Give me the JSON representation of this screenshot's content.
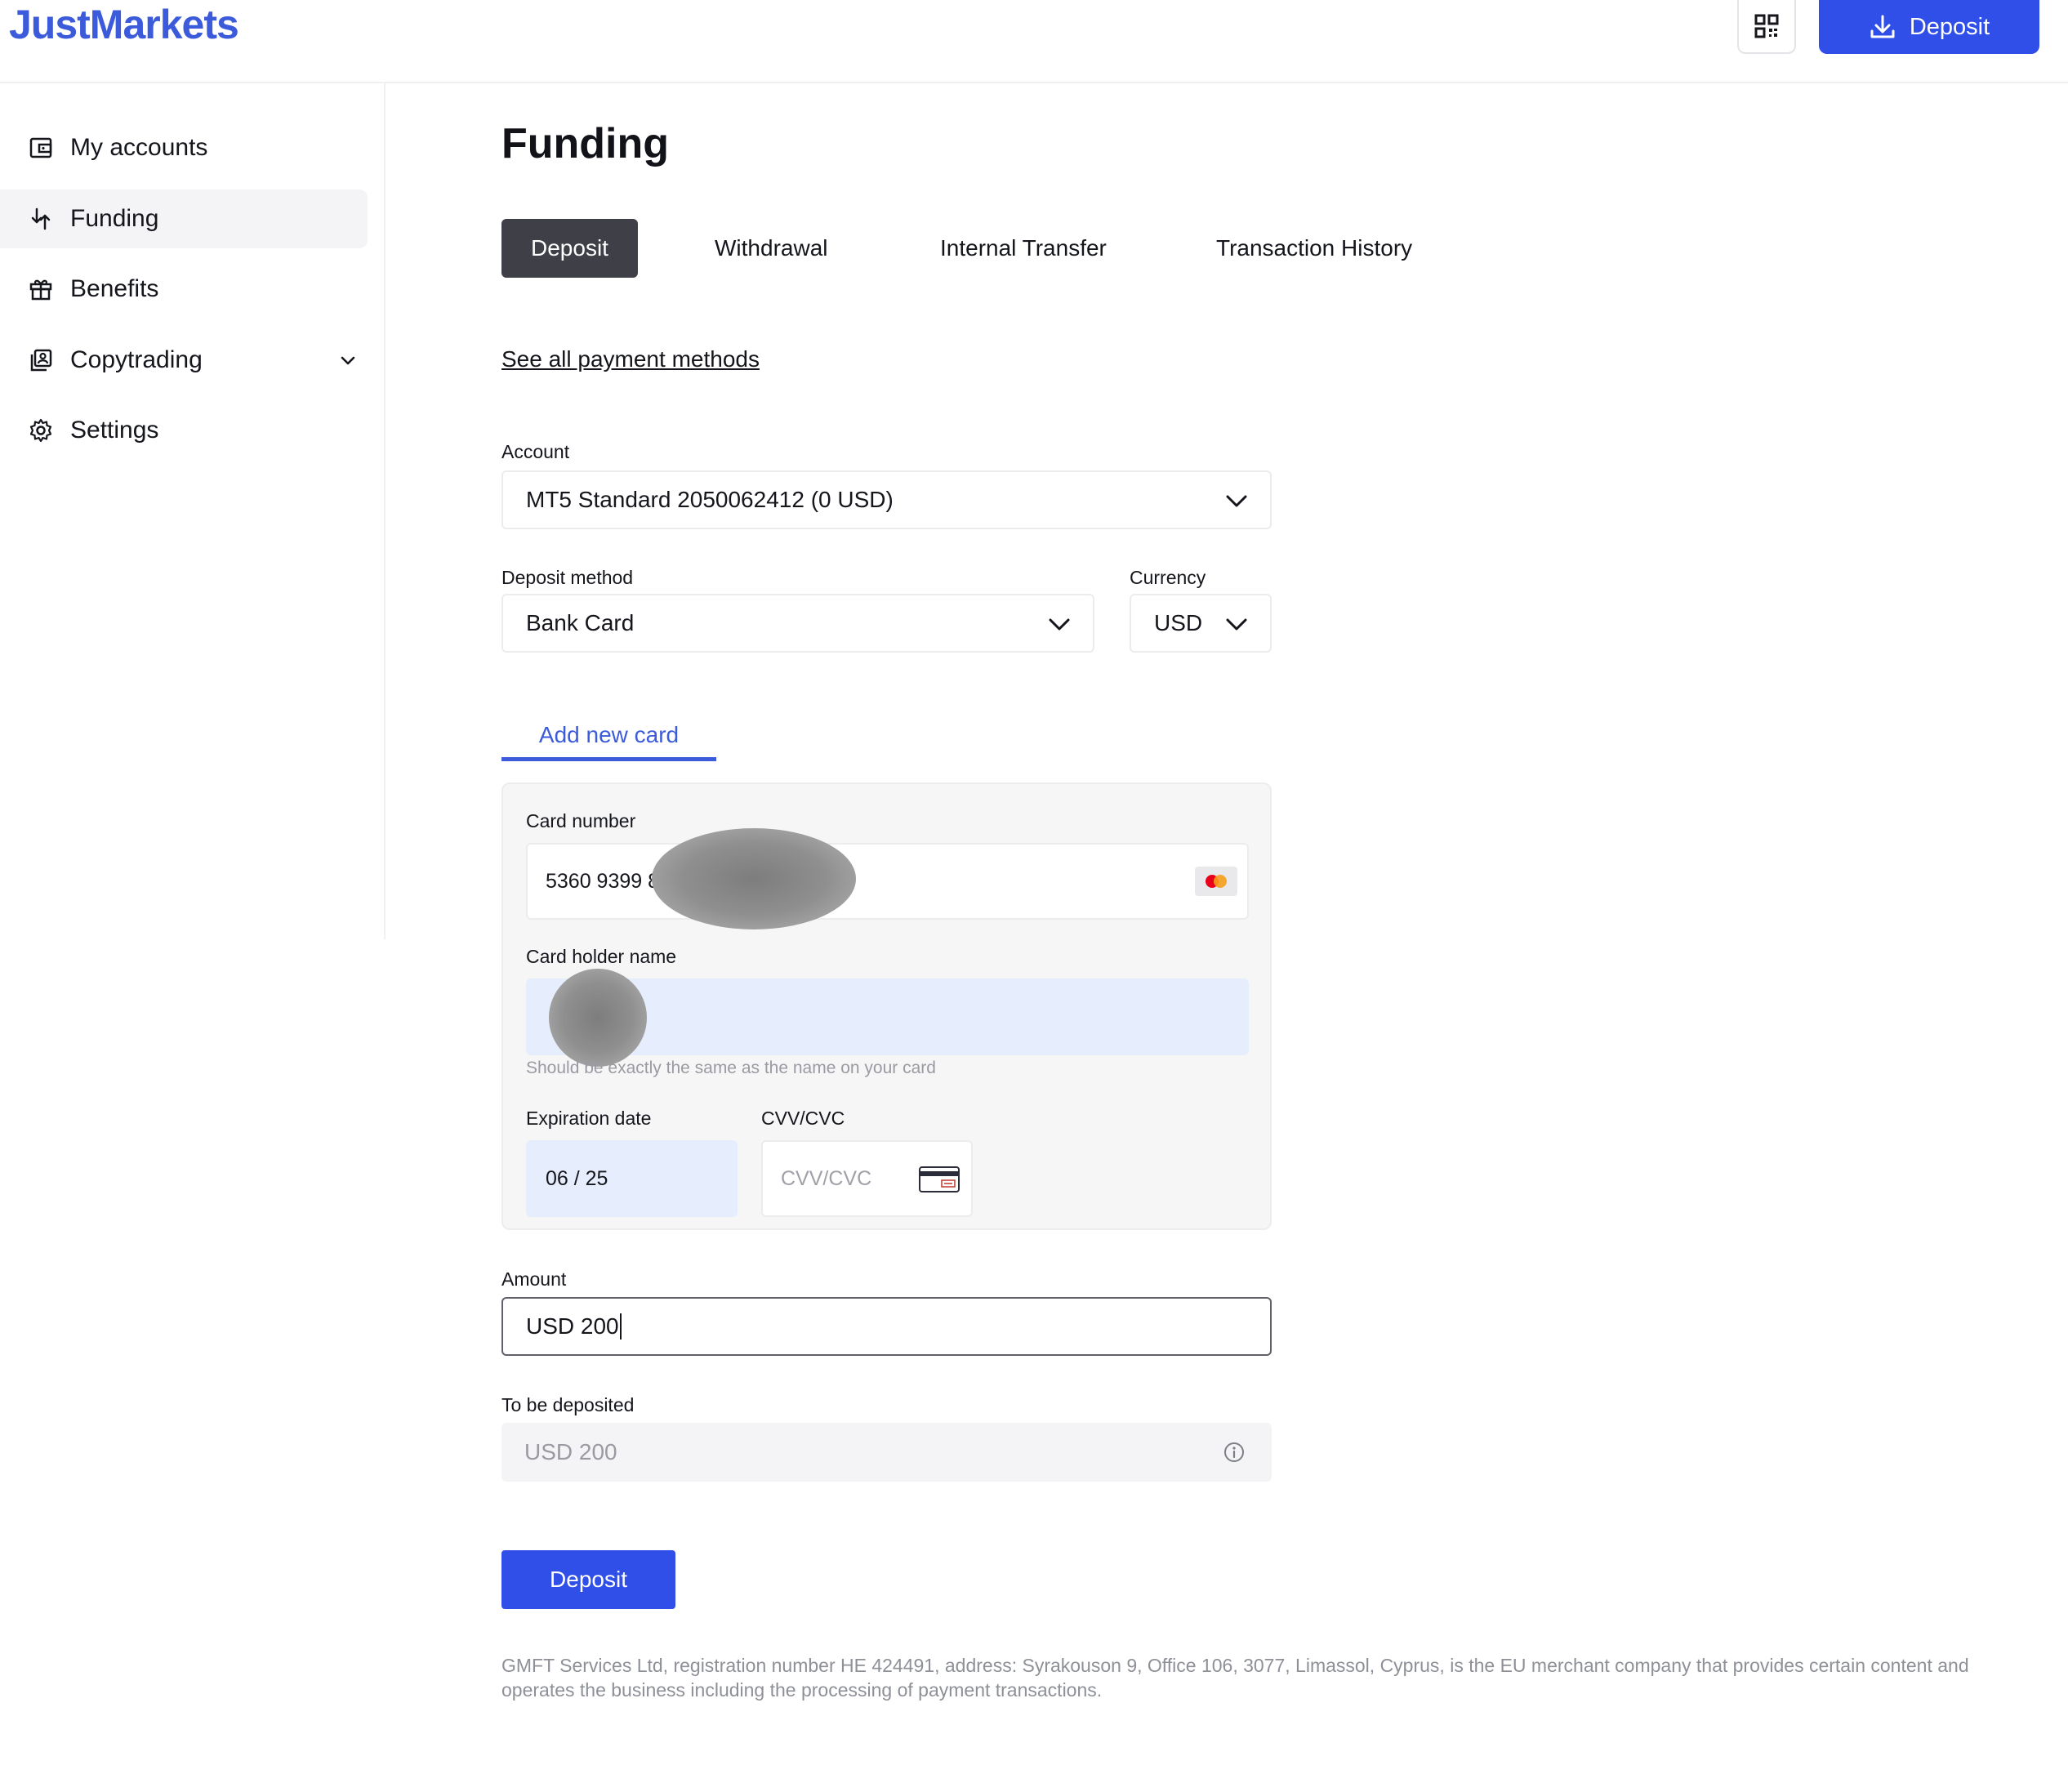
{
  "header": {
    "logo": "JustMarkets",
    "deposit_label": "Deposit"
  },
  "sidebar": {
    "items": [
      {
        "label": "My accounts",
        "icon": "wallet-icon"
      },
      {
        "label": "Funding",
        "icon": "funding-arrows-icon",
        "active": true
      },
      {
        "label": "Benefits",
        "icon": "gift-icon"
      },
      {
        "label": "Copytrading",
        "icon": "copytrading-icon",
        "expandable": true
      },
      {
        "label": "Settings",
        "icon": "gear-icon"
      }
    ]
  },
  "main": {
    "title": "Funding",
    "tabs": [
      {
        "label": "Deposit",
        "active": true
      },
      {
        "label": "Withdrawal"
      },
      {
        "label": "Internal Transfer"
      },
      {
        "label": "Transaction History"
      }
    ],
    "payment_methods_link": "See all payment methods",
    "account": {
      "label": "Account",
      "value": "MT5 Standard 2050062412 (0 USD)"
    },
    "deposit_method": {
      "label": "Deposit method",
      "value": "Bank Card"
    },
    "currency": {
      "label": "Currency",
      "value": "USD"
    },
    "card_tab": "Add new card",
    "card": {
      "number_label": "Card number",
      "number_value": "5360 9399 80",
      "holder_label": "Card holder name",
      "holder_hint": "Should be exactly the same as the name on your card",
      "expiry_label": "Expiration date",
      "expiry_value": "06 / 25",
      "cvv_label": "CVV/CVC",
      "cvv_placeholder": "CVV/CVC"
    },
    "amount": {
      "label": "Amount",
      "value": "USD 200"
    },
    "to_be_deposited": {
      "label": "To be deposited",
      "value": "USD 200"
    },
    "submit_label": "Deposit",
    "footer": "GMFT Services Ltd, registration number HE 424491, address: Syrakouson 9, Office 106, 3077, Limassol, Cyprus, is the EU merchant company that provides certain content and operates the business including the processing of payment transactions."
  },
  "colors": {
    "brand": "#3b5bdb",
    "primary_button": "#2f4fe8",
    "active_tab": "#3e3f47",
    "filled_field": "#e6edfd"
  }
}
